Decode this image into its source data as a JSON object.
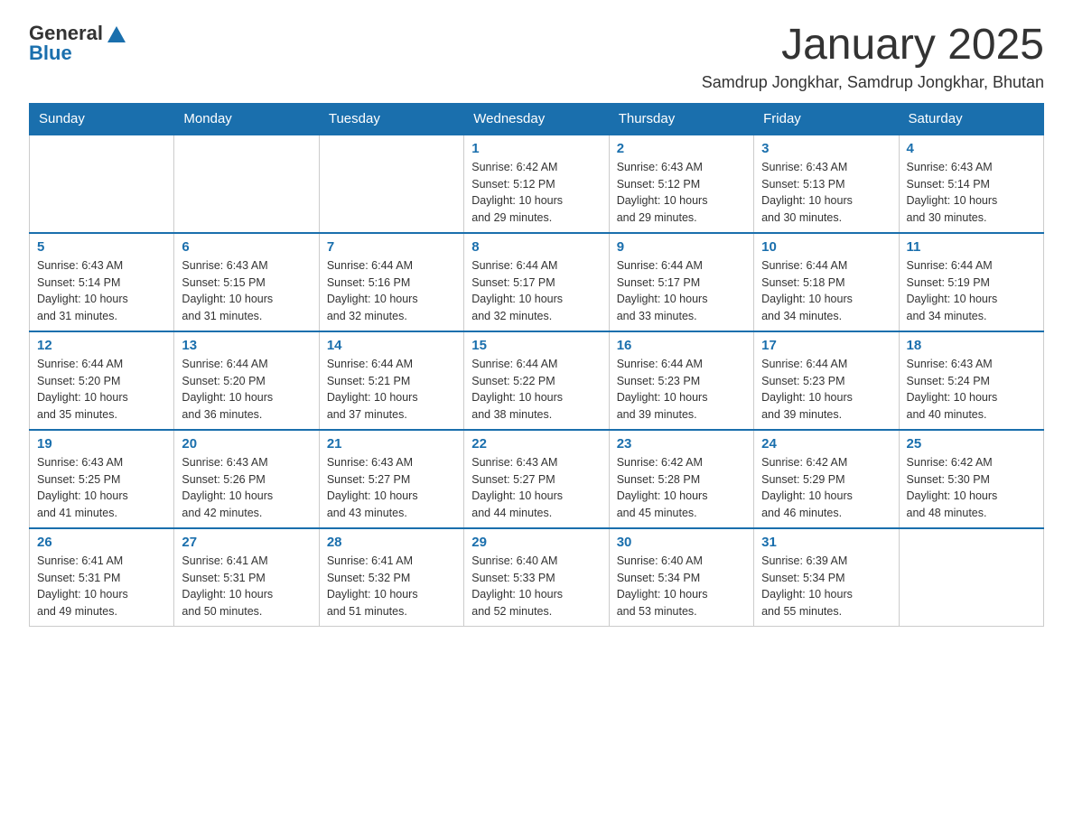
{
  "header": {
    "logo_general": "General",
    "logo_blue": "Blue",
    "month_title": "January 2025",
    "location": "Samdrup Jongkhar, Samdrup Jongkhar, Bhutan"
  },
  "days_of_week": [
    "Sunday",
    "Monday",
    "Tuesday",
    "Wednesday",
    "Thursday",
    "Friday",
    "Saturday"
  ],
  "weeks": [
    [
      {
        "day": "",
        "info": ""
      },
      {
        "day": "",
        "info": ""
      },
      {
        "day": "",
        "info": ""
      },
      {
        "day": "1",
        "info": "Sunrise: 6:42 AM\nSunset: 5:12 PM\nDaylight: 10 hours\nand 29 minutes."
      },
      {
        "day": "2",
        "info": "Sunrise: 6:43 AM\nSunset: 5:12 PM\nDaylight: 10 hours\nand 29 minutes."
      },
      {
        "day": "3",
        "info": "Sunrise: 6:43 AM\nSunset: 5:13 PM\nDaylight: 10 hours\nand 30 minutes."
      },
      {
        "day": "4",
        "info": "Sunrise: 6:43 AM\nSunset: 5:14 PM\nDaylight: 10 hours\nand 30 minutes."
      }
    ],
    [
      {
        "day": "5",
        "info": "Sunrise: 6:43 AM\nSunset: 5:14 PM\nDaylight: 10 hours\nand 31 minutes."
      },
      {
        "day": "6",
        "info": "Sunrise: 6:43 AM\nSunset: 5:15 PM\nDaylight: 10 hours\nand 31 minutes."
      },
      {
        "day": "7",
        "info": "Sunrise: 6:44 AM\nSunset: 5:16 PM\nDaylight: 10 hours\nand 32 minutes."
      },
      {
        "day": "8",
        "info": "Sunrise: 6:44 AM\nSunset: 5:17 PM\nDaylight: 10 hours\nand 32 minutes."
      },
      {
        "day": "9",
        "info": "Sunrise: 6:44 AM\nSunset: 5:17 PM\nDaylight: 10 hours\nand 33 minutes."
      },
      {
        "day": "10",
        "info": "Sunrise: 6:44 AM\nSunset: 5:18 PM\nDaylight: 10 hours\nand 34 minutes."
      },
      {
        "day": "11",
        "info": "Sunrise: 6:44 AM\nSunset: 5:19 PM\nDaylight: 10 hours\nand 34 minutes."
      }
    ],
    [
      {
        "day": "12",
        "info": "Sunrise: 6:44 AM\nSunset: 5:20 PM\nDaylight: 10 hours\nand 35 minutes."
      },
      {
        "day": "13",
        "info": "Sunrise: 6:44 AM\nSunset: 5:20 PM\nDaylight: 10 hours\nand 36 minutes."
      },
      {
        "day": "14",
        "info": "Sunrise: 6:44 AM\nSunset: 5:21 PM\nDaylight: 10 hours\nand 37 minutes."
      },
      {
        "day": "15",
        "info": "Sunrise: 6:44 AM\nSunset: 5:22 PM\nDaylight: 10 hours\nand 38 minutes."
      },
      {
        "day": "16",
        "info": "Sunrise: 6:44 AM\nSunset: 5:23 PM\nDaylight: 10 hours\nand 39 minutes."
      },
      {
        "day": "17",
        "info": "Sunrise: 6:44 AM\nSunset: 5:23 PM\nDaylight: 10 hours\nand 39 minutes."
      },
      {
        "day": "18",
        "info": "Sunrise: 6:43 AM\nSunset: 5:24 PM\nDaylight: 10 hours\nand 40 minutes."
      }
    ],
    [
      {
        "day": "19",
        "info": "Sunrise: 6:43 AM\nSunset: 5:25 PM\nDaylight: 10 hours\nand 41 minutes."
      },
      {
        "day": "20",
        "info": "Sunrise: 6:43 AM\nSunset: 5:26 PM\nDaylight: 10 hours\nand 42 minutes."
      },
      {
        "day": "21",
        "info": "Sunrise: 6:43 AM\nSunset: 5:27 PM\nDaylight: 10 hours\nand 43 minutes."
      },
      {
        "day": "22",
        "info": "Sunrise: 6:43 AM\nSunset: 5:27 PM\nDaylight: 10 hours\nand 44 minutes."
      },
      {
        "day": "23",
        "info": "Sunrise: 6:42 AM\nSunset: 5:28 PM\nDaylight: 10 hours\nand 45 minutes."
      },
      {
        "day": "24",
        "info": "Sunrise: 6:42 AM\nSunset: 5:29 PM\nDaylight: 10 hours\nand 46 minutes."
      },
      {
        "day": "25",
        "info": "Sunrise: 6:42 AM\nSunset: 5:30 PM\nDaylight: 10 hours\nand 48 minutes."
      }
    ],
    [
      {
        "day": "26",
        "info": "Sunrise: 6:41 AM\nSunset: 5:31 PM\nDaylight: 10 hours\nand 49 minutes."
      },
      {
        "day": "27",
        "info": "Sunrise: 6:41 AM\nSunset: 5:31 PM\nDaylight: 10 hours\nand 50 minutes."
      },
      {
        "day": "28",
        "info": "Sunrise: 6:41 AM\nSunset: 5:32 PM\nDaylight: 10 hours\nand 51 minutes."
      },
      {
        "day": "29",
        "info": "Sunrise: 6:40 AM\nSunset: 5:33 PM\nDaylight: 10 hours\nand 52 minutes."
      },
      {
        "day": "30",
        "info": "Sunrise: 6:40 AM\nSunset: 5:34 PM\nDaylight: 10 hours\nand 53 minutes."
      },
      {
        "day": "31",
        "info": "Sunrise: 6:39 AM\nSunset: 5:34 PM\nDaylight: 10 hours\nand 55 minutes."
      },
      {
        "day": "",
        "info": ""
      }
    ]
  ]
}
